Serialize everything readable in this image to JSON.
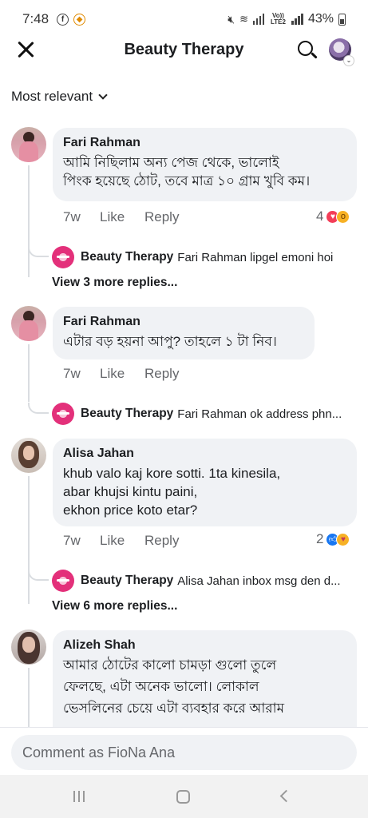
{
  "status_bar": {
    "time": "7:48",
    "battery": "43%",
    "lte_label": "Vo)) LTE2"
  },
  "header": {
    "title": "Beauty Therapy"
  },
  "sort": {
    "label": "Most relevant"
  },
  "comments": [
    {
      "author": "Fari Rahman",
      "text_lines": [
        "আমি নিছিলাম অন্য পেজ থেকে, ভালোই",
        "পিংক হয়েছে ঠোট, তবে মাত্র ১০ গ্রাম খুবি কম।"
      ],
      "time": "7w",
      "like": "Like",
      "reply": "Reply",
      "reaction_count": "4",
      "reply_preview": {
        "author": "Beauty Therapy",
        "text": "Fari Rahman lipgel emoni hoi"
      },
      "view_more": "View 3 more replies..."
    },
    {
      "author": "Fari Rahman",
      "text_lines": [
        "এটার বড় হয়না আপু? তাহলে ১ টা নিব।"
      ],
      "time": "7w",
      "like": "Like",
      "reply": "Reply",
      "reply_preview": {
        "author": "Beauty Therapy",
        "text": "Fari Rahman ok address  phn..."
      }
    },
    {
      "author": "Alisa Jahan",
      "text_lines": [
        "khub valo kaj kore sotti.  1ta kinesila,",
        "abar khujsi kintu paini,",
        "ekhon price koto etar?"
      ],
      "time": "7w",
      "like": "Like",
      "reply": "Reply",
      "reaction_count": "2",
      "reply_preview": {
        "author": "Beauty Therapy",
        "text": "Alisa Jahan inbox  msg den d..."
      },
      "view_more": "View 6 more replies..."
    },
    {
      "author": "Alizeh Shah",
      "text_lines": [
        "আমার ঠোটের কালো চামড়া গুলো তুলে",
        "ফেলছে, এটা অনেক ভালো। লোকাল",
        "ভেসলিনের চেয়ে এটা ব্যবহার করে আরাম"
      ]
    }
  ],
  "comment_box": {
    "placeholder": "Comment as FioNa Ana"
  },
  "colors": {
    "bubble": "#f0f2f5",
    "love": "#f33e58",
    "like": "#1877f2",
    "page_avatar": "#e3307a"
  },
  "icons": [
    "close-icon",
    "search-icon",
    "chevron-down-icon",
    "love-reaction-icon",
    "wow-reaction-icon",
    "like-reaction-icon",
    "care-reaction-icon"
  ]
}
